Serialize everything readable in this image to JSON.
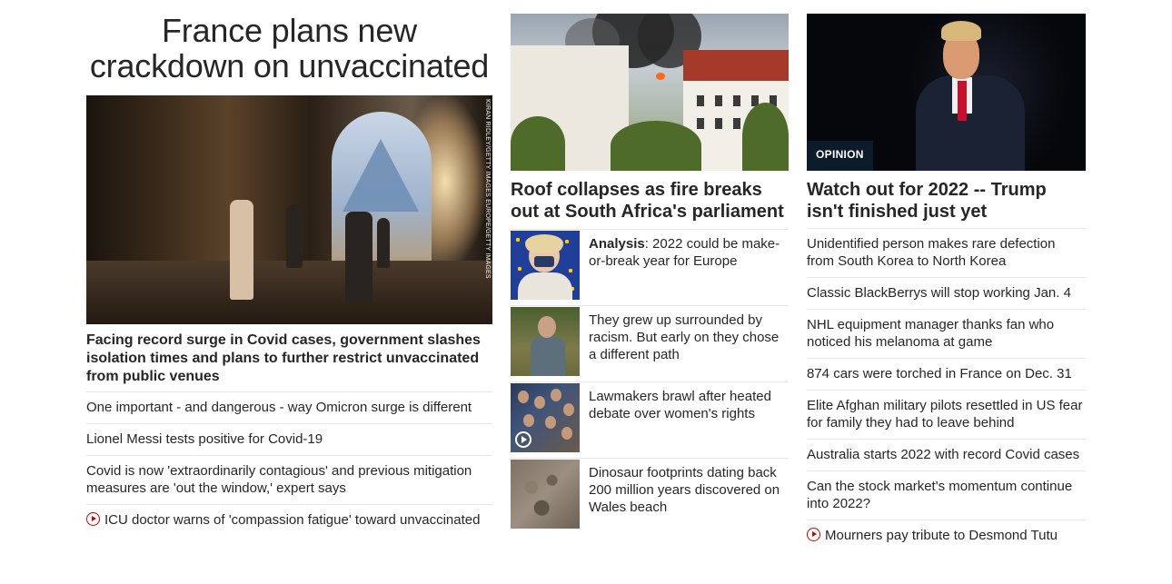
{
  "left": {
    "banner_headline": "France plans new crackdown on unvaccinated",
    "hero_credit": "KIRAN RIDLEY/GETTY IMAGES EUROPE/GETTY IMAGES",
    "lead_caption": "Facing record surge in Covid cases, government slashes isolation times and plans to further restrict unvaccinated from public venues",
    "items": [
      {
        "text": "One important - and dangerous - way Omicron surge is different",
        "video": false
      },
      {
        "text": "Lionel Messi tests positive for Covid-19",
        "video": false
      },
      {
        "text": "Covid is now 'extraordinarily contagious' and previous mitigation measures are 'out the window,' expert says",
        "video": false
      },
      {
        "text": "ICU doctor warns of 'compassion fatigue' toward unvaccinated",
        "video": true
      }
    ]
  },
  "middle": {
    "headline": "Roof collapses as fire breaks out at South Africa's parliament",
    "items": [
      {
        "label": "Analysis",
        "text": ": 2022 could be make-or-break year for Europe",
        "thumb": "eu-politician-photo"
      },
      {
        "label": "",
        "text": "They grew up surrounded by racism. But early on they chose a different path",
        "thumb": "man-sitting-photo"
      },
      {
        "label": "",
        "text": "Lawmakers brawl after heated debate over women's rights",
        "thumb": "parliament-brawl-photo",
        "video": true
      },
      {
        "label": "",
        "text": "Dinosaur footprints dating back 200 million years discovered on Wales beach",
        "thumb": "dinosaur-footprint-photo"
      }
    ]
  },
  "right": {
    "badge": "OPINION",
    "headline": "Watch out for 2022 -- Trump isn't finished just yet",
    "items": [
      {
        "text": "Unidentified person makes rare defection from South Korea to North Korea",
        "video": false
      },
      {
        "text": "Classic BlackBerrys will stop working Jan. 4",
        "video": false
      },
      {
        "text": "NHL equipment manager thanks fan who noticed his melanoma at game",
        "video": false
      },
      {
        "text": "874 cars were torched in France on Dec. 31",
        "video": false
      },
      {
        "text": "Elite Afghan military pilots resettled in US fear for family they had to leave behind",
        "video": false
      },
      {
        "text": "Australia starts 2022 with record Covid cases",
        "video": false
      },
      {
        "text": "Can the stock market's momentum continue into 2022?",
        "video": false
      },
      {
        "text": "Mourners pay tribute to Desmond Tutu",
        "video": true
      }
    ]
  },
  "colors": {
    "text": "#262626",
    "divider": "#e6e6e6",
    "video_red": "#cc0000",
    "opinion_badge": "#0c1b2a"
  }
}
